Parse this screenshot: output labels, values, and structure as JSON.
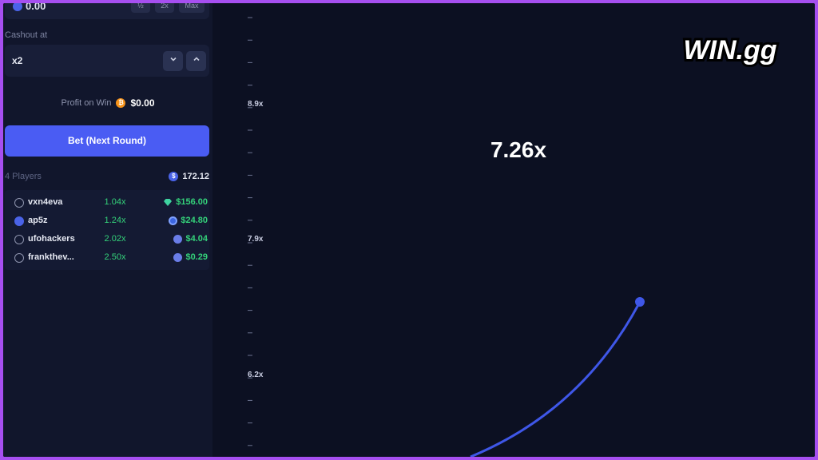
{
  "bet_amount": {
    "value": "0.00",
    "quick_buttons": [
      "½",
      "2x",
      "Max"
    ]
  },
  "cashout": {
    "label": "Cashout at",
    "value": "x2"
  },
  "profit": {
    "label": "Profit on Win",
    "value": "$0.00"
  },
  "bet_button": {
    "label": "Bet (Next Round)"
  },
  "players": {
    "count_label": "4 Players",
    "total": "172.12",
    "rows": [
      {
        "name": "vxn4eva",
        "multiplier": "1.04x",
        "amount": "$156.00",
        "currency_icon": "gem-icon"
      },
      {
        "name": "ap5z",
        "multiplier": "1.24x",
        "amount": "$24.80",
        "currency_icon": "crypto-coin-icon"
      },
      {
        "name": "ufohackers",
        "multiplier": "2.02x",
        "amount": "$4.04",
        "currency_icon": "ethereum-icon"
      },
      {
        "name": "frankthev...",
        "multiplier": "2.50x",
        "amount": "$0.29",
        "currency_icon": "ethereum-icon"
      }
    ]
  },
  "crash": {
    "multiplier": "7.26x",
    "y_axis_labels": [
      "8.9x",
      "7.9x",
      "6.2x"
    ]
  },
  "logo": {
    "text": "WIN.gg"
  },
  "colors": {
    "accent": "#4a5cf3",
    "win_green": "#34d27a",
    "background": "#0c1022",
    "panel": "#11162c",
    "frame_border": "#a64ff0"
  }
}
